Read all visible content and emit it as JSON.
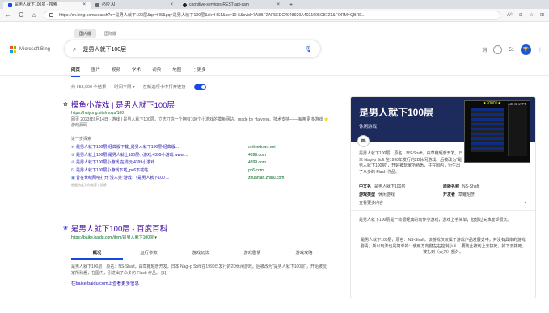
{
  "browser": {
    "tabs": [
      {
        "label": "是男人就下100层 - 搜索",
        "color": "#174ae4",
        "active": true
      },
      {
        "label": "必应 AI",
        "color": "#6b6b6b",
        "active": false
      },
      {
        "label": "cognitive-services-REST-api-sam",
        "color": "#222222",
        "active": false
      }
    ],
    "url": "https://cn.bing.com/search?q=是男人就下100层&qs=HS&pq=是男人就下100层&sk=HS1&sc=10-5&cvid=7A8BF2AF5EDC4948929A4021605C8721&FORM=QBRE...",
    "back": "←",
    "refresh": "C",
    "home": "⌂",
    "read_aloud": "A⁰",
    "extensions": "⊕",
    "favorites": "☆",
    "collections": "⊞"
  },
  "search": {
    "scopes": [
      "国内版",
      "国际版"
    ],
    "logo_text": "Microsoft Bing",
    "query": "是男人就下100层",
    "lang_button": "消",
    "points": "51",
    "nav": [
      "网页",
      "图片",
      "视频",
      "学术",
      "词典",
      "地图",
      "⋮更多"
    ],
    "result_count": "约 658,000 个结果",
    "time_filter": "时间不限 ▾",
    "newtab_label": "在新选项卡中打开链接"
  },
  "result1": {
    "title": "摸鱼小游戏 | 是男人就下100层",
    "url": "https://haiyong.site/moyu/100",
    "snippet": "网页 2023年6月14日 · 游戏 | 是男人就下100层，立志打造一个拥有100个小游戏的摸鱼网站。made by Haiyong。技术支持——海拥 更多游戏 ⭐ 游戏源码",
    "more_label": "进一步探索",
    "links": [
      {
        "icon": "◕",
        "text": "是男人就下100层-经典版下载_是男人就下100层-经典版...",
        "domain": "onlinedown.net"
      },
      {
        "icon": "⊕",
        "text": "是男人就上100层,是男人就上100层小游戏,4399小游戏 www ...",
        "domain": "4399.com"
      },
      {
        "icon": "⊕",
        "text": "是男人就下100层小游戏,在线玩,4399小游戏",
        "domain": "4399.com"
      },
      {
        "icon": "6",
        "text": "是男人就下100层小游戏下载_pc6下载站",
        "domain": "pc6.com"
      },
      {
        "icon": "▣",
        "text": "曾在世纪网吧打开''没人类''游戏：《是男人就下100 ...",
        "domain": "zhuanlan.zhihu.com"
      }
    ],
    "disclaimer": "根据热度为你推荐 • 反馈"
  },
  "result2": {
    "title": "是男人就下100层 - 百度百科",
    "url": "https://baike.baidu.com/item/是男人就下100层 ▾",
    "tabs": [
      "概况",
      "运行参数",
      "游戏玩法",
      "游戏剧情",
      "游戏攻略"
    ],
    "snippet": "是男人就下100层，原名：NS-Shaft，由草薙昭彦开发，日本 Nagi-p Soft 在1990年发行的2D休闲游戏。后被改为\"是男人就下100层\"，开始被玩家所熟悉，在国内，引进出了众多的 Flash 作品。 [1]",
    "link": "在baike.baidu.com上查看更多信息"
  },
  "panel": {
    "title": "是男人就下100层",
    "subtitle": "休闲游戏",
    "screenshot_score": "★70001★",
    "screenshot_level": "NS-SHAFT",
    "description": "是男人就下100层，原名：NS-Shaft，由草薙昭彦开发，日本 Nagi-p Soft 在1990年发行的2D休闲游戏。后被改为\"是男人就下100层\"，开始被玩家所熟悉，并在国内，衍生出了众多的 Flash 作品。",
    "facts": [
      {
        "label": "中文名",
        "value": "是男人就下100层"
      },
      {
        "label": "原版名称",
        "value": "NS-Shaft"
      },
      {
        "label": "游戏类型",
        "value": "休闲游戏"
      },
      {
        "label": "开发者",
        "value": "草薙昭彦"
      }
    ],
    "view_all": "查看更多内容",
    "para2": "是男人就下100层是一款很经典的动作小游戏，游戏上手简单，但想过关难度却很大。",
    "para3": "是男人就下100层，原名：NS-Shaft。该游戏仅仅属于游戏作品发展史中，并没有具体的游戏剧情，所以玩法也是简单的：使用方向键左右控制小人，要防止被刺上去挤死，掉下去摔死。被扎到（大刀）额外。"
  }
}
